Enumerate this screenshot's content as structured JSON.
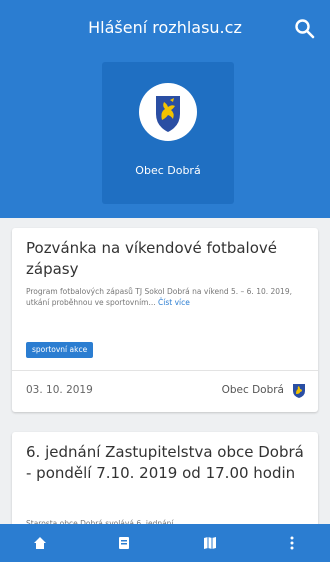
{
  "header": {
    "title": "Hlášení rozhlasu.cz",
    "search_icon": "search-icon",
    "logo_label": "Obec Dobrá"
  },
  "colors": {
    "primary": "#2b7dd1",
    "tile": "#1f6fc2",
    "emblem_shield": "#2a4ea3",
    "emblem_animal": "#f2c200"
  },
  "feed": [
    {
      "title": "Pozvánka na víkendové fotbalové zápasy",
      "description": "Program fotbalových zápasů TJ Sokol Dobrá na víkend 5. – 6. 10. 2019, utkání proběhnou ve sportovním...",
      "read_more": "Číst více",
      "tag": "sportovní akce",
      "date": "03. 10. 2019",
      "source": "Obec Dobrá"
    },
    {
      "title": "6. jednání Zastupitelstva obce Dobrá - pondělí 7.10. 2019 od 17.00 hodin",
      "description": "Starosta obce Dobrá svolává 6. jednání"
    }
  ],
  "bottom_nav": {
    "items": [
      "home-icon",
      "news-icon",
      "map-icon",
      "more-icon"
    ]
  }
}
